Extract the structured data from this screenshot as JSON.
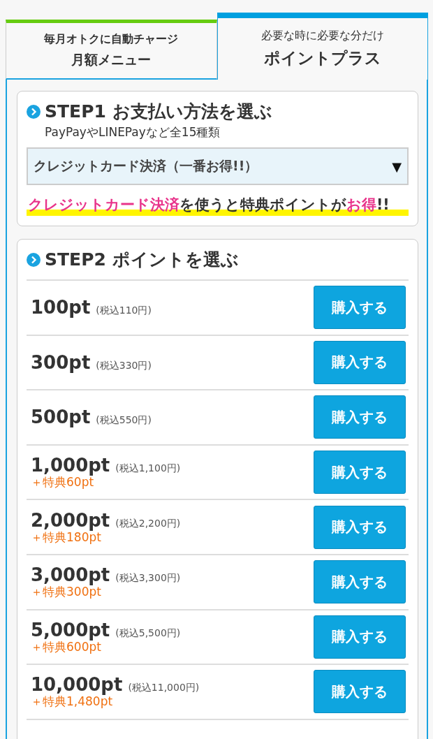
{
  "tabs": [
    {
      "subtitle": "毎月オトクに自動チャージ",
      "label": "月額メニュー",
      "selected": false,
      "color": "#66cc11"
    },
    {
      "subtitle": "必要な時に必要な分だけ",
      "label": "ポイントプラス",
      "selected": true,
      "color": "#00a0e0"
    }
  ],
  "step1": {
    "title": "STEP1 お支払い方法を選ぶ",
    "note": "PayPayやLINEPayなど全15種類",
    "select": {
      "value": "クレジットカード決済（一番お得!!）",
      "caret": "▼"
    },
    "promo": [
      {
        "text": "クレジットカード決済",
        "emphasis": true
      },
      {
        "text": "を使うと特典ポイントが",
        "emphasis": false
      },
      {
        "text": "お得",
        "emphasis": true
      },
      {
        "text": "!!",
        "emphasis": false
      }
    ]
  },
  "step2": {
    "title": "STEP2 ポイントを選ぶ",
    "options": [
      {
        "points": "100pt",
        "price": "(税込110円)",
        "button": "購入する"
      },
      {
        "points": "300pt",
        "price": "(税込330円)",
        "button": "購入する"
      },
      {
        "points": "500pt",
        "price": "(税込550円)",
        "button": "購入する"
      },
      {
        "points": "1,000pt",
        "price": "(税込1,100円)",
        "bonus": "＋特典60pt",
        "button": "購入する"
      },
      {
        "points": "2,000pt",
        "price": "(税込2,200円)",
        "bonus": "＋特典180pt",
        "button": "購入する"
      },
      {
        "points": "3,000pt",
        "price": "(税込3,300円)",
        "bonus": "＋特典300pt",
        "button": "購入する"
      },
      {
        "points": "5,000pt",
        "price": "(税込5,500円)",
        "bonus": "＋特典600pt",
        "button": "購入する"
      },
      {
        "points": "10,000pt",
        "price": "(税込11,000円)",
        "bonus": "＋特典1,480pt",
        "button": "購入する"
      }
    ]
  }
}
